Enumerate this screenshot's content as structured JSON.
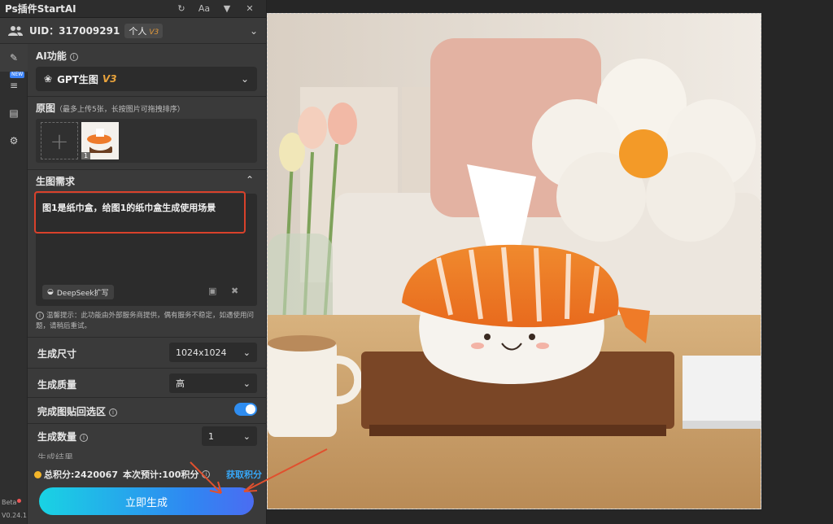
{
  "titlebar": {
    "title": "Ps插件StartAI",
    "icons": [
      "refresh-icon",
      "font-size-icon",
      "pin-icon",
      "close-icon"
    ],
    "font_label": "Aa"
  },
  "user": {
    "uid_label": "UID：317009291",
    "plan": "个人",
    "plan_version": "V3"
  },
  "rail": {
    "new_badge": "NEW",
    "beta": "Beta",
    "version": "V0.24.1"
  },
  "ai": {
    "label": "AI功能",
    "model": "GPT生图",
    "model_version": "V3"
  },
  "source": {
    "label": "原图",
    "note": "（最多上传5张，长按图片可拖拽排序）",
    "add": "+",
    "thumb_index": "1"
  },
  "prompt": {
    "label": "生图需求",
    "text": "图1是纸巾盒，给图1的纸巾盒生成使用场景",
    "deepseek": "DeepSeek扩写",
    "hint": "温馨提示：此功能由外部服务商提供，偶有服务不稳定，如遇使用问题，请稍后重试。"
  },
  "settings": {
    "size_label": "生成尺寸",
    "size_value": "1024x1024",
    "quality_label": "生成质量",
    "quality_value": "高",
    "paste_label": "完成图贴回选区",
    "paste_enabled": true,
    "count_label": "生成数量",
    "count_value": "1",
    "partial_row": "生成结果"
  },
  "footer": {
    "points": "总积分:2420067",
    "estimate": "本次预计:100积分",
    "get_points": "获取积分",
    "generate": "立即生成"
  },
  "colors": {
    "accent": "#2f8df0",
    "highlight_border": "#d9412b",
    "v3": "#e9a33c",
    "arrow": "#e0502e"
  }
}
